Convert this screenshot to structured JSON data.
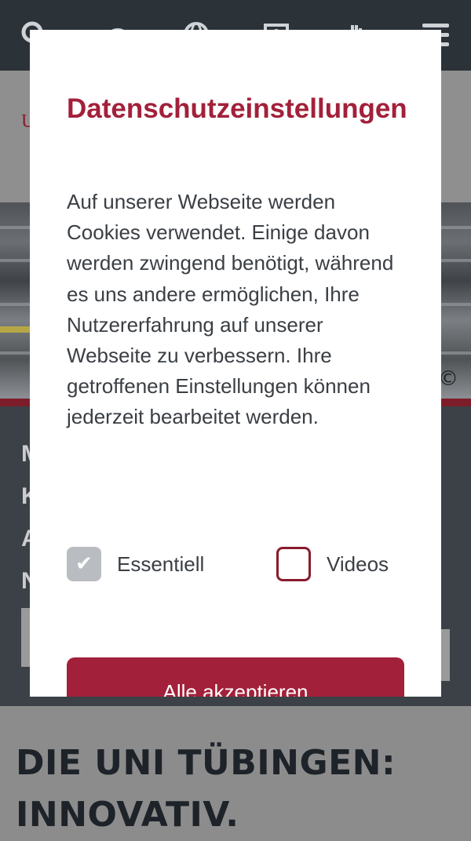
{
  "topbar": {
    "icons": [
      "search-icon",
      "gauge-icon",
      "globe-icon",
      "portrait-icon",
      "hand-icon",
      "menu-icon"
    ],
    "color": "#2b3238"
  },
  "background": {
    "logo_letter": "U",
    "copyright": "©",
    "dark_letters": [
      "M",
      "K",
      "A",
      "N"
    ],
    "headline": "DIE UNI TÜBINGEN: INNOVATIV."
  },
  "modal": {
    "title": "Datenschutzeinstellungen",
    "text": "Auf unserer Webseite werden Cookies verwendet. Einige davon werden zwingend benötigt, während es uns andere ermöglichen, Ihre Nutzererfahrung auf unserer Webseite zu verbessern. Ihre getroffenen Einstellungen können jederzeit bearbeitet werden.",
    "options": {
      "essentiell": {
        "label": "Essentiell",
        "checked": true,
        "disabled": true
      },
      "videos": {
        "label": "Videos",
        "checked": false
      }
    },
    "accept_label": "Alle akzeptieren",
    "accent_color": "#a3203a"
  }
}
